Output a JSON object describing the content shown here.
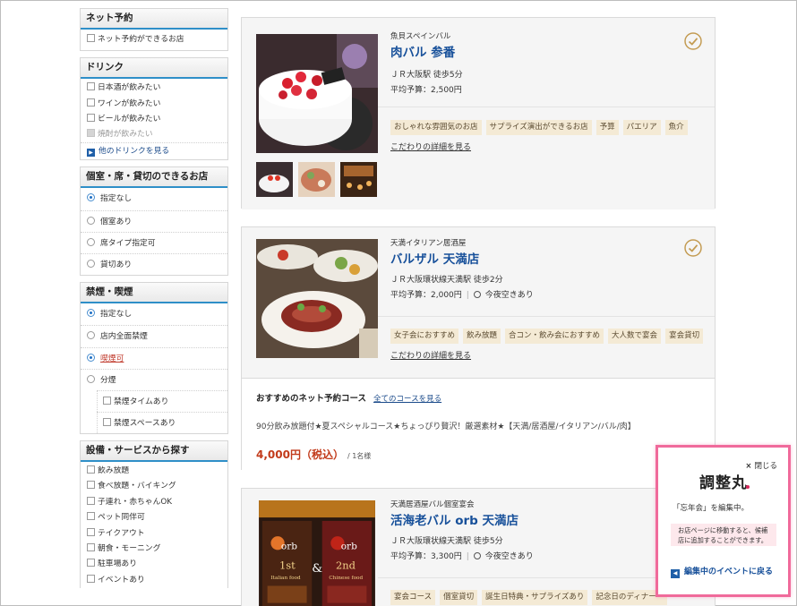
{
  "sidebar": {
    "net_reservation": {
      "title": "ネット予約",
      "items": [
        "ネット予約ができるお店"
      ]
    },
    "drink": {
      "title": "ドリンク",
      "items": [
        "日本酒が飲みたい",
        "ワインが飲みたい",
        "ビールが飲みたい"
      ],
      "disabled_item": "焼酎が飲みたい",
      "more_link": "他のドリンクを見る"
    },
    "private_room": {
      "title": "個室・席・貸切のできるお店",
      "options": [
        "指定なし",
        "個室あり",
        "席タイプ指定可",
        "貸切あり"
      ]
    },
    "smoking": {
      "title": "禁煙・喫煙",
      "options": [
        "指定なし",
        "店内全面禁煙",
        "喫煙可",
        "分煙"
      ],
      "sub_options": [
        "禁煙タイムあり",
        "禁煙スペースあり"
      ]
    },
    "facility": {
      "title": "設備・サービスから探す",
      "items": [
        "飲み放題",
        "食べ放題・バイキング",
        "子連れ・赤ちゃんOK",
        "ペット同伴可",
        "テイクアウト",
        "朝食・モーニング",
        "駐車場あり",
        "イベントあり"
      ]
    }
  },
  "restaurants": [
    {
      "genre": "魚貝スペインバル",
      "name": "肉バル 参番",
      "access": "ＪＲ大阪駅 徒歩5分",
      "budget": "平均予算：2,500円",
      "tags": [
        "おしゃれな雰囲気のお店",
        "サプライズ演出ができるお店",
        "予算",
        "パエリア",
        "魚介"
      ],
      "detail_link": "こだわりの詳細を見る"
    },
    {
      "genre": "天満イタリアン居酒屋",
      "name": "バルザル 天満店",
      "access": "ＪＲ大阪環状線天満駅 徒歩2分",
      "budget": "平均予算：2,000円",
      "availability": "今夜空きあり",
      "tags": [
        "女子会におすすめ",
        "飲み放題",
        "合コン・飲み会におすすめ",
        "大人数で宴会",
        "宴会貸切"
      ],
      "detail_link": "こだわりの詳細を見る",
      "course": {
        "heading": "おすすめのネット予約コース",
        "all_link": "全てのコースを見る",
        "title": "90分飲み放題付★夏スペシャルコース★ちょっぴり贅沢！厳選素材★【天満/居酒屋/イタリアン/バル/肉】",
        "price": "4,000円（税込）",
        "per": "/ 1名様"
      }
    },
    {
      "genre": "天満居酒屋バル個室宴会",
      "name": "活海老バル orb 天満店",
      "access": "ＪＲ大阪環状線天満駅 徒歩5分",
      "budget": "平均予算：3,300円",
      "availability": "今夜空きあり",
      "tags": [
        "宴会コース",
        "個室貸切",
        "誕生日特典・サプライズあり",
        "記念日のディナー・"
      ],
      "photo_text": {
        "left_brand": "orb",
        "left_floor": "1st",
        "left_caption": "Italian food",
        "amp": "&",
        "right_brand": "orb",
        "right_floor": "2nd",
        "right_caption": "Chinese food"
      }
    }
  ],
  "popup": {
    "close_label": "閉じる",
    "logo": "調整丸",
    "editing_text": "「忘年会」を編集中。",
    "note": "お店ページに移動すると、候補店に追加することができます。",
    "back_link": "編集中のイベントに戻る"
  },
  "colors": {
    "accent_blue": "#2f8fc8",
    "shop_name": "#17509a",
    "tag_bg": "#f4ead5",
    "price_red": "#c23a1a",
    "popup_border": "#f06a9b"
  }
}
